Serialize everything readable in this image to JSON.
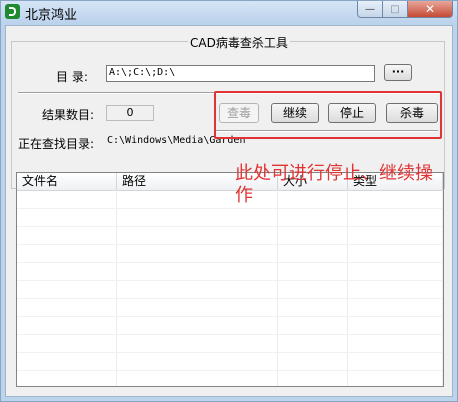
{
  "window": {
    "title": "北京鸿业",
    "controls": {
      "minimize": "—",
      "maximize": "□",
      "close": "✕"
    }
  },
  "group": {
    "title": "CAD病毒查杀工具"
  },
  "directory": {
    "label": "目  录:",
    "value": "A:\\;C:\\;D:\\",
    "browse_label": "···"
  },
  "result": {
    "label": "结果数目:",
    "count": "0"
  },
  "searching": {
    "label": "正在查找目录:",
    "value": "C:\\Windows\\Media\\Garden"
  },
  "buttons": {
    "check": "查毒",
    "continue": "继续",
    "stop": "停止",
    "kill": "杀毒"
  },
  "table": {
    "columns": [
      "文件名",
      "路径",
      "大小",
      "类型"
    ]
  },
  "annotation": {
    "text": "此处可进行停止、继续操作",
    "color": "#e03434"
  }
}
